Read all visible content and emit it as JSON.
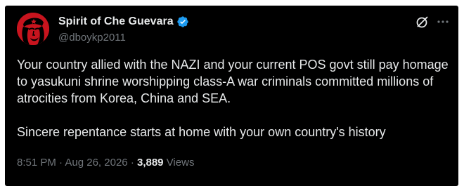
{
  "tweet": {
    "author": {
      "display_name": "Spirit of Che Guevara",
      "handle": "@dboykp2011",
      "verified": true
    },
    "text": [
      "Your country allied with the NAZI and your current POS govt still pay homage to yasukuni shrine worshipping class-A war criminals committed millions of atrocities from Korea, China and SEA.",
      "Sincere repentance starts at home with your own country's history"
    ],
    "time": "8:51 PM",
    "separator": "·",
    "date": "Aug 26, 2026",
    "views_count": "3,889",
    "views_label": "Views"
  },
  "icons": {
    "verified": "verified-badge-icon",
    "grok": "grok-icon",
    "more": "more-icon"
  },
  "colors": {
    "background": "#000000",
    "text": "#e7e9ea",
    "secondary_text": "#71767b",
    "verified_blue": "#1d9bf0",
    "avatar_red": "#c8141e"
  }
}
